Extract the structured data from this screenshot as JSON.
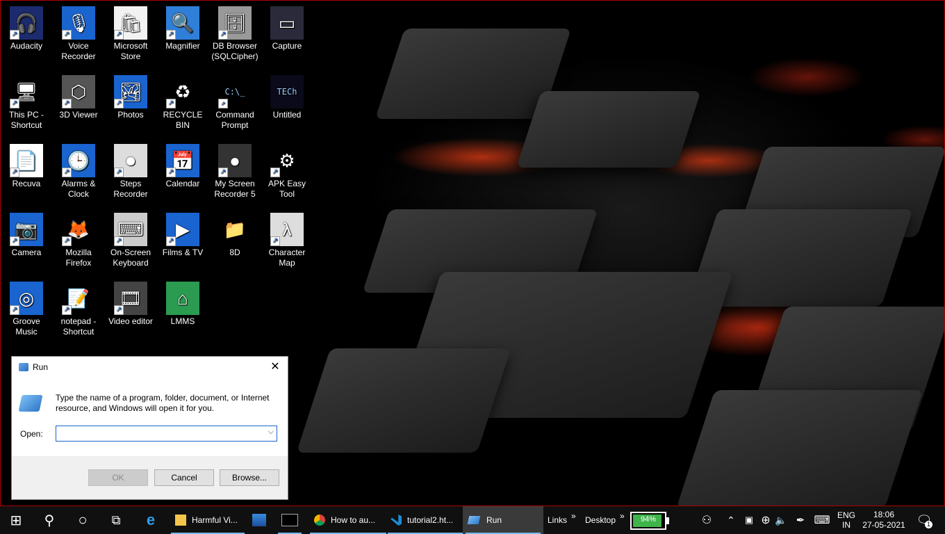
{
  "desktop": {
    "icons": [
      {
        "label": "Audacity",
        "glyph": "🎧",
        "bg": "#1c2a6e",
        "shortcut": true
      },
      {
        "label": "Voice\nRecorder",
        "glyph": "🎙",
        "bg": "#1a64d0",
        "shortcut": true
      },
      {
        "label": "Microsoft\nStore",
        "glyph": "🛍",
        "bg": "#f2f2f2",
        "shortcut": true
      },
      {
        "label": "Magnifier",
        "glyph": "🔍",
        "bg": "#2f7fd8",
        "shortcut": true
      },
      {
        "label": "DB Browser\n(SQLCipher)",
        "glyph": "🗄",
        "bg": "#999",
        "shortcut": true
      },
      {
        "label": "Capture",
        "glyph": "▭",
        "bg": "#2a2a3a",
        "shortcut": false
      },
      {
        "label": "This PC -\nShortcut",
        "glyph": "🖥",
        "bg": "transparent",
        "shortcut": true
      },
      {
        "label": "3D Viewer",
        "glyph": "⬡",
        "bg": "#555",
        "shortcut": true
      },
      {
        "label": "Photos",
        "glyph": "🏞",
        "bg": "#1a64d0",
        "shortcut": true
      },
      {
        "label": "RECYCLE\nBIN",
        "glyph": "♻",
        "bg": "transparent",
        "shortcut": true
      },
      {
        "label": "Command\nPrompt",
        "glyph": "C:\\_",
        "bg": "#000",
        "shortcut": true
      },
      {
        "label": "Untitled",
        "glyph": "TECh",
        "bg": "#0a0a1a",
        "shortcut": false
      },
      {
        "label": "Recuva",
        "glyph": "📄",
        "bg": "#fff",
        "shortcut": true
      },
      {
        "label": "Alarms &\nClock",
        "glyph": "🕒",
        "bg": "#1a64d0",
        "shortcut": true
      },
      {
        "label": "Steps\nRecorder",
        "glyph": "⏺",
        "bg": "#ddd",
        "shortcut": true
      },
      {
        "label": "Calendar",
        "glyph": "📅",
        "bg": "#1a64d0",
        "shortcut": true
      },
      {
        "label": "My Screen\nRecorder 5",
        "glyph": "●",
        "bg": "#333",
        "shortcut": true
      },
      {
        "label": "APK Easy\nTool",
        "glyph": "⚙",
        "bg": "#000",
        "shortcut": true
      },
      {
        "label": "Camera",
        "glyph": "📷",
        "bg": "#1a64d0",
        "shortcut": true
      },
      {
        "label": "Mozilla\nFirefox",
        "glyph": "🦊",
        "bg": "transparent",
        "shortcut": true
      },
      {
        "label": "On-Screen\nKeyboard",
        "glyph": "⌨",
        "bg": "#ccc",
        "shortcut": true
      },
      {
        "label": "Films & TV",
        "glyph": "▶",
        "bg": "#1a64d0",
        "shortcut": true
      },
      {
        "label": "8D",
        "glyph": "📁",
        "bg": "transparent",
        "shortcut": false
      },
      {
        "label": "Character\nMap",
        "glyph": "λ",
        "bg": "#ddd",
        "shortcut": true
      },
      {
        "label": "Groove\nMusic",
        "glyph": "◎",
        "bg": "#1a64d0",
        "shortcut": true
      },
      {
        "label": "notepad -\nShortcut",
        "glyph": "📝",
        "bg": "transparent",
        "shortcut": true
      },
      {
        "label": "Video editor",
        "glyph": "🎞",
        "bg": "#444",
        "shortcut": true
      },
      {
        "label": "LMMS",
        "glyph": "⌂",
        "bg": "#2a9b50",
        "shortcut": false
      }
    ]
  },
  "run_dialog": {
    "title": "Run",
    "close_glyph": "✕",
    "description": "Type the name of a program, folder, document, or Internet resource, and Windows will open it for you.",
    "open_label": "Open:",
    "open_value": "",
    "dropdown_glyph": "⌵",
    "ok_label": "OK",
    "cancel_label": "Cancel",
    "browse_label": "Browse..."
  },
  "taskbar": {
    "start_glyph": "⊞",
    "search_glyph": "⚲",
    "cortana_glyph": "○",
    "taskview_glyph": "⧉",
    "edge_glyph": "e",
    "explorer_label": "Harmful Vi...",
    "chrome_label": "How to au...",
    "vscode_label": "tutorial2.ht...",
    "run_label": "Run",
    "links_label": "Links",
    "desktop_label": "Desktop",
    "chevron": "»",
    "battery_percent": 94,
    "battery_label": "94%",
    "lang_line1": "ENG",
    "lang_line2": "IN",
    "time": "18:06",
    "date": "27-05-2021",
    "notification_count": "1",
    "accent": "#76b9ed"
  }
}
